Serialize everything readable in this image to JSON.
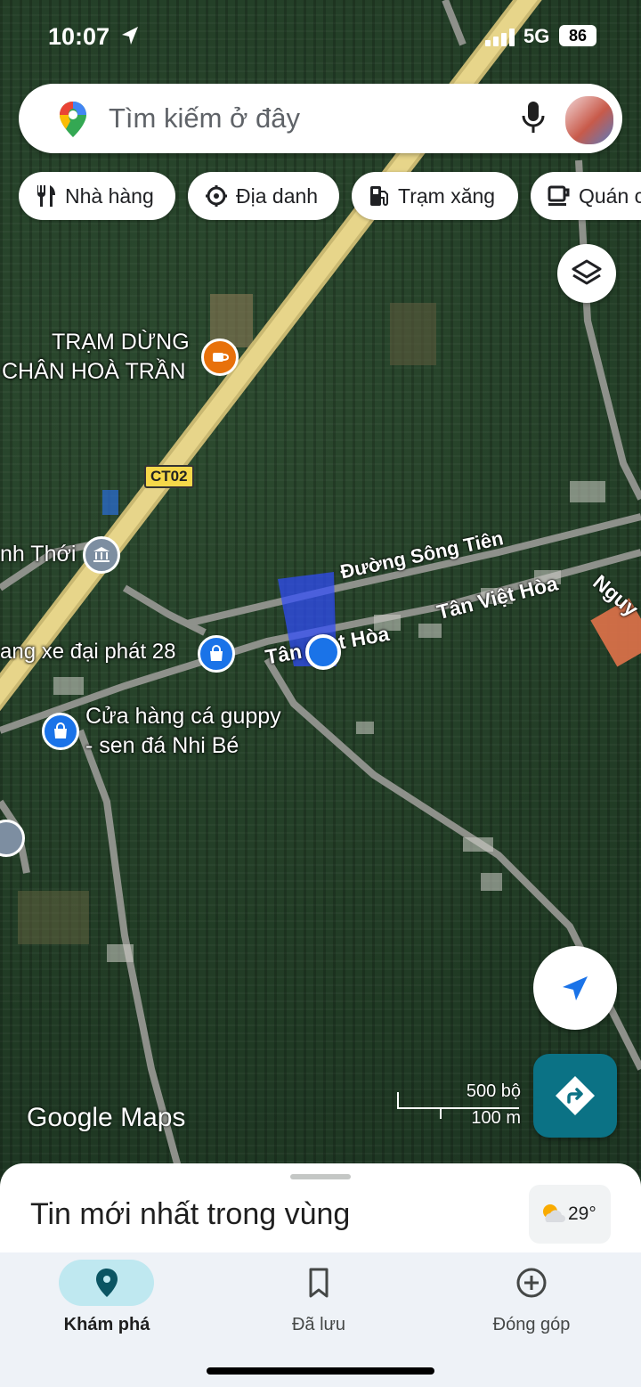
{
  "status_bar": {
    "time": "10:07",
    "network": "5G",
    "battery": "86"
  },
  "search": {
    "placeholder": "Tìm kiếm ở đây"
  },
  "chips": [
    {
      "label": "Nhà hàng",
      "icon": "fork-knife-icon"
    },
    {
      "label": "Địa danh",
      "icon": "landmark-icon"
    },
    {
      "label": "Trạm xăng",
      "icon": "gas-station-icon"
    },
    {
      "label": "Quán c",
      "icon": "coffee-cup-icon"
    }
  ],
  "map": {
    "place_labels": {
      "rest_stop_line1": "TRẠM DỪNG",
      "rest_stop_line2": "CHÂN HOÀ TRẦN",
      "route_shield": "CT02",
      "village": "nh Thới",
      "street_song_tien": "Đường Sông Tiên",
      "street_tan_viet_hoa_1": "Tân Việt Hòa",
      "street_tan_viet_hoa_2": "Tân",
      "street_tan_viet_hoa_3": "t Hòa",
      "street_nguy": "Nguy",
      "shop_xe": "ang xe đại phát 28",
      "shop_guppy_line1": "Cửa hàng cá guppy",
      "shop_guppy_line2": "- sen đá Nhi Bé"
    },
    "scale": {
      "imperial": "500 bộ",
      "metric": "100 m"
    },
    "logo": "Google Maps"
  },
  "sheet": {
    "title": "Tin mới nhất trong vùng",
    "temperature": "29°"
  },
  "nav": [
    {
      "label": "Khám phá",
      "icon": "explore-pin-icon",
      "active": true
    },
    {
      "label": "Đã lưu",
      "icon": "bookmark-icon",
      "active": false
    },
    {
      "label": "Đóng góp",
      "icon": "add-circle-icon",
      "active": false
    }
  ],
  "colors": {
    "accent": "#0b7285",
    "location": "#1a73e8",
    "poi_blue": "#1a73e8",
    "poi_orange": "#e8710a"
  }
}
